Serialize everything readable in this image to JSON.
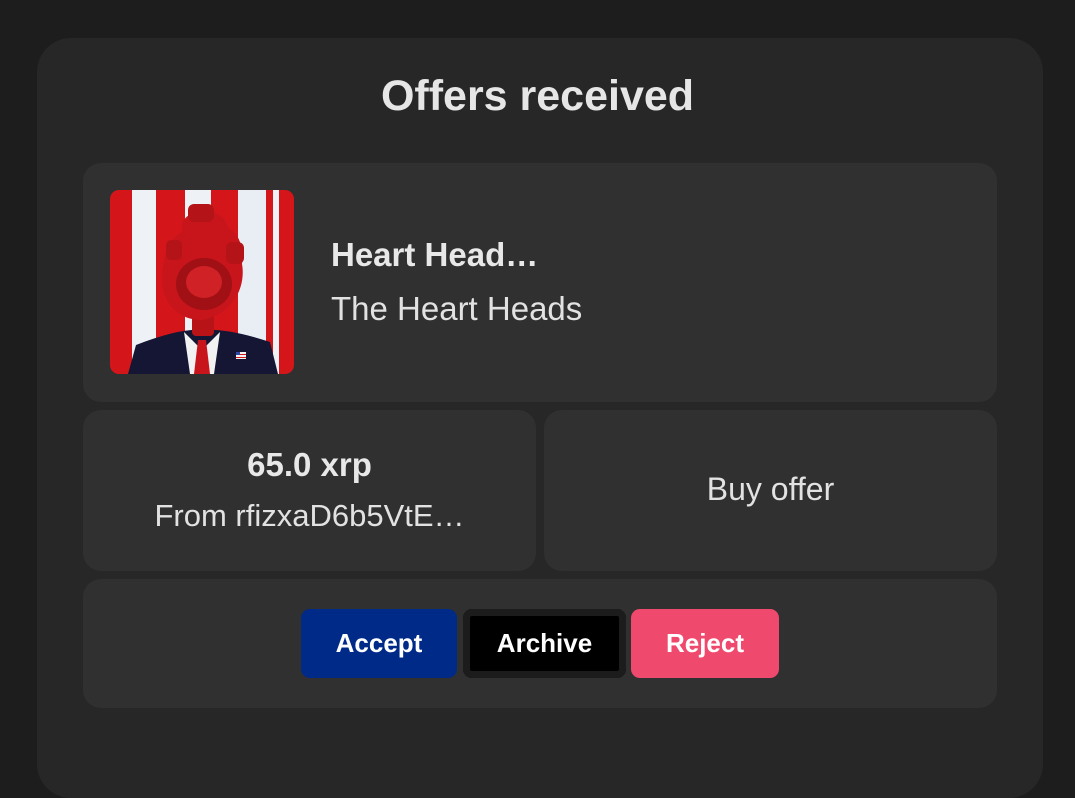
{
  "dialog": {
    "title": "Offers received"
  },
  "nft": {
    "name": "Heart Head…",
    "collection": "The Heart Heads",
    "thumbnail_icon": "heart-head-artwork"
  },
  "offer": {
    "price": "65.0 xrp",
    "from": "From rfizxaD6b5VtE…",
    "type": "Buy offer"
  },
  "actions": {
    "accept_label": "Accept",
    "archive_label": "Archive",
    "reject_label": "Reject"
  },
  "colors": {
    "background": "#1d1d1d",
    "panel": "#272727",
    "card": "#303030",
    "accept": "#002a88",
    "archive": "#000000",
    "reject": "#ef4a6d"
  }
}
